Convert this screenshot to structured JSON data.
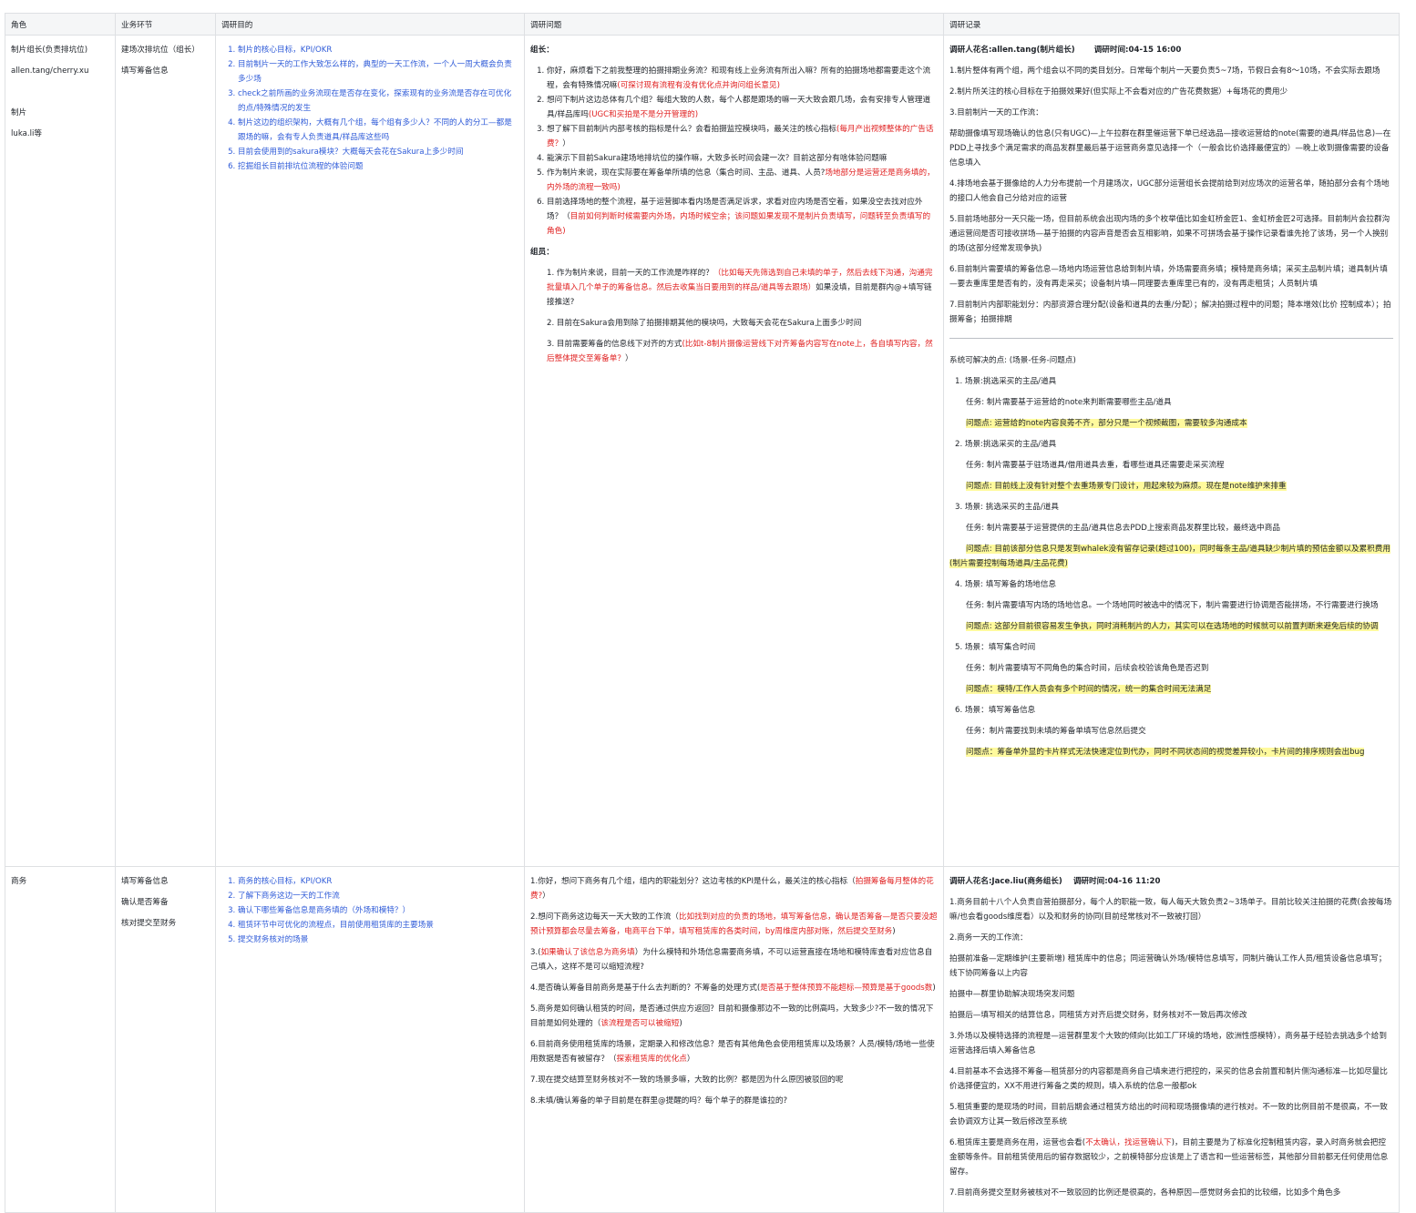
{
  "headers": [
    "角色",
    "业务环节",
    "调研目的",
    "调研问题",
    "调研记录"
  ],
  "row1": {
    "role": [
      "制片组长(负责排坑位)",
      "allen.tang/cherry.xu",
      "",
      "制片",
      "luka.li等"
    ],
    "biz": [
      "建场次排坑位（组长）",
      "填写筹备信息"
    ],
    "goals": [
      "制片的核心目标，KPI/OKR",
      "目前制片一天的工作大致怎么样的，典型的一天工作流，一个人一周大概会负责多少场",
      "check之前所画的业务流现在是否存在变化，探索现有的业务流是否存在可优化的点/特殊情况的发生",
      "制片这边的组织架构，大概有几个组，每个组有多少人？不同的人的分工—都是跟场的嘛，会有专人负责道具/样品库这些吗",
      "目前会使用到的sakura模块？大概每天会花在Sakura上多少时间",
      "挖掘组长目前排坑位流程的体验问题"
    ],
    "q_leader_title": "组长：",
    "q_leader": [
      {
        "t": "你好，麻烦看下之前我整理的拍摄排期业务流？和现有线上业务流有所出入嘛？所有的拍摄场地都需要走这个流程，会有特殊情况嘛",
        "r": "(可探讨现有流程有没有优化点并询问组长意见)"
      },
      {
        "t": "想问下制片这边总体有几个组？每组大致的人数，每个人都是跟场的嘛一天大致会跟几场，会有安排专人管理道具/样品库吗",
        "r": "(UGC和买拍是不是分开管理的)"
      },
      {
        "t": "想了解下目前制片内部考核的指标是什么？会看拍摄监控模块吗，最关注的核心指标",
        "r": "(每月产出视频整体的广告话费？",
        "t2": "）"
      },
      {
        "t": "能演示下目前Sakura建场地排坑位的操作嘛，大致多长时间会建一次？目前这部分有啥体验问题嘛",
        "r": ""
      },
      {
        "t": "作为制片来说，现在实际要在筹备单所填的信息（集合时间、主品、道具、人员?",
        "r": "场地部分是运营还是商务填的，内外场的流程一致吗)"
      },
      {
        "t": "目前选择场地的整个流程，基于运营脚本看内场是否满足诉求，求看对应内场是否空着，如果没空去找对应外场？（",
        "r": "目前如何判断时候需要内外场，内场时候空余；该问题如果发现不是制片负责填写，问题转至负责填写的角色)"
      }
    ],
    "q_member_title": "组员：",
    "q_member": [
      {
        "t": "1. 作为制片来说，目前一天的工作流是咋样的？",
        "r": "（比如每天先筛选到自己未填的单子，然后去线下沟通，沟通完批量填入几个单子的筹备信息。然后去收集当日要用到的样品/道具等去跟场）",
        "t2": "如果没填，目前是群内@+填写链接推送?"
      },
      {
        "t": "2. 目前在Sakura会用到除了拍摄排期其他的模块吗，大致每天会花在Sakura上面多少时间",
        "r": ""
      },
      {
        "t": "3. 目前需要筹备的信息线下对齐的方式",
        "r": "(比如t-8制片摄像运营线下对齐筹备内容写在note上，各自填写内容，然后整体提交至筹备单？",
        "t2": "）"
      }
    ],
    "rec_header": {
      "person": "调研人花名:allen.tang(制片组长)",
      "time": "调研时间:04-15 16:00"
    },
    "records": [
      "1.制片整体有两个组，两个组会以不同的类目划分。日常每个制片一天要负责5~7场，节假日会有8～10场，不会实际去跟场",
      "2.制片所关注的核心目标在于拍摄效果好(但实际上不会看对应的广告花费数据）+每场花的费用少",
      "3.目前制片一天的工作流：",
      "帮助摄像填写现场确认的信息(只有UGC)—上午拉群在群里催运营下单已经选品—接收运营给的note(需要的道具/样品信息)—在PDD上寻找多个满足需求的商品发群里最后基于运营商务意见选择一个（一般会比价选择最便宜的）—晚上收到摄像需要的设备信息填入",
      "4.排场地会基于摄像给的人力分布提前一个月建场次，UGC部分运营组长会提前给到对应场次的运营名单，随拍部分会有个场地的接口人他会自己分给对应的运营",
      "5.目前场地部分一天只能一场，但目前系统会出现内场的多个枚举值比如金虹桥金匠1、金虹桥金匠2可选择。目前制片会拉群沟通运营间是否可接收拼场—基于拍摄的内容声音是否会互相影响，如果不可拼场会基于操作记录看谁先抢了该场，另一个人换别的场(这部分经常发现争执)",
      "6.目前制片需要填的筹备信息—场地内场运营信息给到制片填，外场需要商务填；模特是商务填；采买主品制片填；道具制片填—要去重库里是否有的，没有再走采买；设备制片填—同理要去重库里已有的，没有再走租赁；人员制片填",
      "7.目前制片内部职能划分：内部资源合理分配(设备和道具的去重/分配）；解决拍摄过程中的问题；降本增效(比价 控制成本）；拍摄筹备；拍摄排期"
    ],
    "solve_title": "系统可解决的点: (场景-任务-问题点)",
    "solve": [
      {
        "scene": "1.  场景:挑选采买的主品/道具",
        "task": "任务: 制片需要基于运营给的note来判断需要哪些主品/道具",
        "issue": "问题点: 运营给的note内容良莠不齐，部分只是一个视频截图，需要较多沟通成本"
      },
      {
        "scene": "2.  场景:挑选采买的主品/道具",
        "task": "任务: 制片需要基于驻场道具/借用道具去重，看哪些道具还需要走采买流程",
        "issue": "问题点: 目前线上没有针对整个去重场景专门设计，用起来较为麻烦。现在是note维护来排重"
      },
      {
        "scene": "3.  场景: 挑选采买的主品/道具",
        "task": "任务: 制片需要基于运营提供的主品/道具信息去PDD上搜索商品发群里比较，最终选中商品",
        "issue": "问题点: 目前该部分信息只是发到whalek没有留存记录(超过100)，同时每条主品/道具缺少制片填的预估金额以及累积费用(制片需要控制每场道具/主品花费)"
      },
      {
        "scene": "4.  场景: 填写筹备的场地信息",
        "task": "任务: 制片需要填写内场的场地信息。一个场地同时被选中的情况下，制片需要进行协调是否能拼场，不行需要进行换场",
        "issue": "问题点: 这部分目前很容易发生争执，同时消耗制片的人力，其实可以在选场地的时候就可以前置判断来避免后续的协调"
      },
      {
        "scene": "5.  场景：填写集合时间",
        "task": "任务：制片需要填写不同角色的集合时间，后续会校验该角色是否迟到",
        "issue": "问题点：模特/工作人员会有多个时间的情况，统一的集合时间无法满足"
      },
      {
        "scene": "6.  场景：填写筹备信息",
        "task": "任务：制片需要找到未填的筹备单填写信息然后提交",
        "issue": "问题点：筹备单外显的卡片样式无法快速定位到代办，同时不同状态间的视觉差异较小，卡片间的排序规则会出bug"
      }
    ]
  },
  "row2": {
    "role": [
      "商务"
    ],
    "biz": [
      "填写筹备信息",
      "确认是否筹备",
      "核对提交至财务"
    ],
    "goals": [
      "商务的核心目标，KPI/OKR",
      "了解下商务这边一天的工作流",
      "确认下哪些筹备信息是商务填的（外场和模特？）",
      "租赁环节中可优化的流程点，目前使用租赁库的主要场景",
      "提交财务核对的场景"
    ],
    "questions": [
      {
        "t": "1.你好，想问下商务有几个组，组内的职能划分？这边考核的KPI是什么，最关注的核心指标（",
        "r": "拍摄筹备每月整体的花费?",
        "t2": "）"
      },
      {
        "t": "2.想问下商务这边每天一天大致的工作流（",
        "r": "比如找到对应的负责的场地，填写筹备信息，确认是否筹备—是否只要没超预计预算都会尽量去筹备，电商平台下单，填写租赁库的各类时间，by周维度内部对账，然后提交至财务",
        "t2": ")"
      },
      {
        "t": "3.(",
        "r": "如果确认了该信息为商务填",
        "t2": "）为什么模特和外场信息需要商务填，不可以运营直接在场地和模特库查看对应信息自己填入，这样不是可以缩短流程?"
      },
      {
        "t": "4.是否确认筹备目前商务是基于什么去判断的？不筹备的处理方式(",
        "r": "是否基于整体预算不能超标—预算是基于goods数",
        "t2": ")"
      },
      {
        "t": "5.商务是如何确认租赁的时间，是否通过供应方返回？目前和摄像那边不一致的比例高吗，大致多少?不一致的情况下目前是如何处理的（",
        "r": "该流程是否可以被缩短",
        "t2": ")"
      },
      {
        "t": "6.目前商务使用租赁库的场景，定期录入和修改信息？是否有其他角色会使用租赁库以及场景？人员/模特/场地一些使用数据是否有被留存？（",
        "r": "探索租赁库的优化点",
        "t2": "）"
      },
      {
        "t": "7.现在提交结算至财务核对不一致的场景多嘛，大致的比例？都是因为什么原因被驳回的呢",
        "r": ""
      },
      {
        "t": "8.未填/确认筹备的单子目前是在群里@提醒的吗？每个单子的群是谁拉的?",
        "r": ""
      }
    ],
    "rec_header": {
      "person": "调研人花名:Jace.liu(商务组长)",
      "time": "调研时间:04-16 11:20"
    },
    "records": [
      {
        "t": "1.商务目前十八个人负责自营拍摄部分，每个人的职能一致，每人每天大致负责2~3场单子。目前比较关注拍摄的花费(会按每场嘛/也会看goods维度看）以及和财务的协同(目前经常核对不一致被打回）"
      },
      {
        "t": "2.商务一天的工作流："
      },
      {
        "t": "拍摄前准备—定期维护(主要新增) 租赁库中的信息；同运营确认外场/模特信息填写，同制片确认工作人员/租赁设备信息填写；线下协同筹备以上内容"
      },
      {
        "t": "拍摄中—群里协助解决现场突发问题"
      },
      {
        "t": "拍摄后—填写相关的结算信息，同租赁方对齐后提交财务，财务核对不一致后再次修改"
      },
      {
        "t": "3.外场以及模特选择的流程是—运营群里发个大致的倾向(比如工厂环境的场地，欧洲性感模特），商务基于经验去挑选多个给到运营选择后填入筹备信息"
      },
      {
        "t": "4.目前基本不会选择不筹备—租赁部分的内容都是商务自己填来进行把控的，采买的信息会前置和制片侧沟通标准—比如尽量比价选择便宜的，XX不用进行筹备之类的规则，填入系统的信息一般都ok"
      },
      {
        "t": "5.租赁重要的是现场的时间，目前后期会通过租赁方给出的时间和现场摄像填的进行核对。不一致的比例目前不是很高，不一致会协调双方让其一致后修改至系统"
      },
      {
        "t": "6.租赁库主要是商务在用，运营也会看(",
        "r": "不太确认，找运营确认下",
        "t2": ")，目前主要是为了标准化控制租赁内容，录入时商务就会把控金额等条件。目前租赁使用后的留存数据较少，之前模特部分应该是上了语言和一些运营标签，其他部分目前都无任何使用信息留存。"
      },
      {
        "t": "7.目前商务提交至财务被核对不一致驳回的比例还是很高的，各种原因—感觉财务会扣的比较细，比如多个角色多"
      }
    ]
  }
}
